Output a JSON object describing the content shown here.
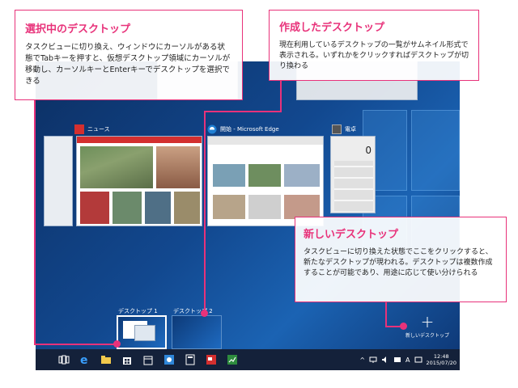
{
  "callouts": {
    "selected": {
      "title": "選択中のデスクトップ",
      "text": "タスクビューに切り換え、ウィンドウにカーソルがある状態でTabキーを押すと、仮想デスクトップ領域にカーソルが移動し、カーソルキーとEnterキーでデスクトップを選択できる"
    },
    "created": {
      "title": "作成したデスクトップ",
      "text": "現在利用しているデスクトップの一覧がサムネイル形式で表示される。いずれかをクリックすればデスクトップが切り換わる"
    },
    "new": {
      "title": "新しいデスクトップ",
      "text": "タスクビューに切り換えた状態でここをクリックすると、新たなデスクトップが現われる。デスクトップは複数作成することが可能であり、用途に応じて使い分けられる"
    }
  },
  "task_view": {
    "windows": [
      {
        "title": "ニュース",
        "icon": "news-icon",
        "color": "#d32f2f"
      },
      {
        "title": "開始 - Microsoft Edge",
        "icon": "edge-icon",
        "color": "#1f7fd3"
      },
      {
        "title": "電卓",
        "icon": "calculator-icon",
        "color": "#555555"
      }
    ]
  },
  "desktops": {
    "items": [
      {
        "label": "デスクトップ 1",
        "selected": true
      },
      {
        "label": "デスクトップ 2",
        "selected": false
      }
    ],
    "new_label": "新しいデスクトップ",
    "new_symbol": "+"
  },
  "taskbar": {
    "icons": [
      "task-view-icon",
      "edge-icon",
      "file-explorer-icon",
      "store-icon",
      "calendar-icon",
      "weather-icon",
      "calculator-icon",
      "news-icon",
      "money-icon"
    ],
    "tray_symbols": {
      "chevron": "^",
      "ime": "A"
    },
    "time": "12:48",
    "date": "2015/07/20"
  },
  "colors": {
    "accent": "#e8327a",
    "taskbar": "#14213a",
    "desktop": "#12488f"
  }
}
